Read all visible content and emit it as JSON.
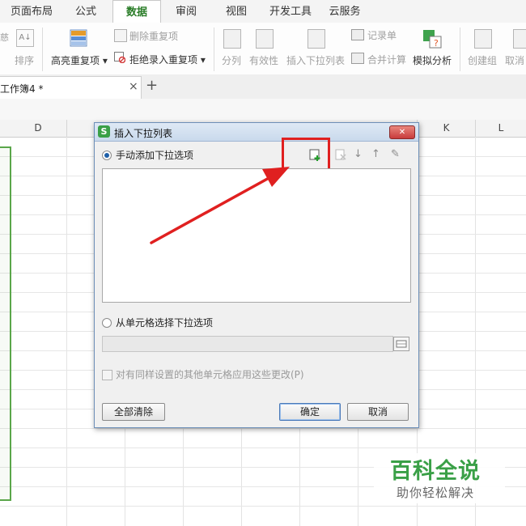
{
  "ribbon_tabs": [
    {
      "label": "页面布局",
      "active": false
    },
    {
      "label": "公式",
      "active": false
    },
    {
      "label": "数据",
      "active": true
    },
    {
      "label": "审阅",
      "active": false
    },
    {
      "label": "视图",
      "active": false
    },
    {
      "label": "开发工具",
      "active": false
    },
    {
      "label": "云服务",
      "active": false
    }
  ],
  "ribbon": {
    "sort": "排序",
    "partial_left": "慈",
    "highlight_dup": "高亮重复项",
    "delete_dup": "删除重复项",
    "reject_dup": "拒绝录入重复项",
    "split": "分列",
    "validity": "有效性",
    "insert_dropdown": "插入下拉列表",
    "record": "记录单",
    "merge_calc": "合并计算",
    "simulate": "模拟分析",
    "create_group": "创建组",
    "cancel_group": "取消"
  },
  "doc_tab": {
    "title": "工作簿4 *",
    "close": "×",
    "add": "+"
  },
  "columns": [
    "D",
    "K",
    "L"
  ],
  "dialog": {
    "title": "插入下拉列表",
    "manual_option": "手动添加下拉选项",
    "cell_option": "从单元格选择下拉选项",
    "apply_checkbox": "对有同样设置的其他单元格应用这些更改(P)",
    "clear_all": "全部清除",
    "ok": "确定",
    "cancel": "取消",
    "close": "✕",
    "app_icon": "S"
  },
  "watermark": {
    "title": "百科全说",
    "subtitle": "助你轻松解决"
  },
  "colors": {
    "accent_green": "#2a7d28",
    "arrow_red": "#e02020",
    "dialog_border": "#6d8fb8",
    "close_red": "#c83c3c"
  }
}
